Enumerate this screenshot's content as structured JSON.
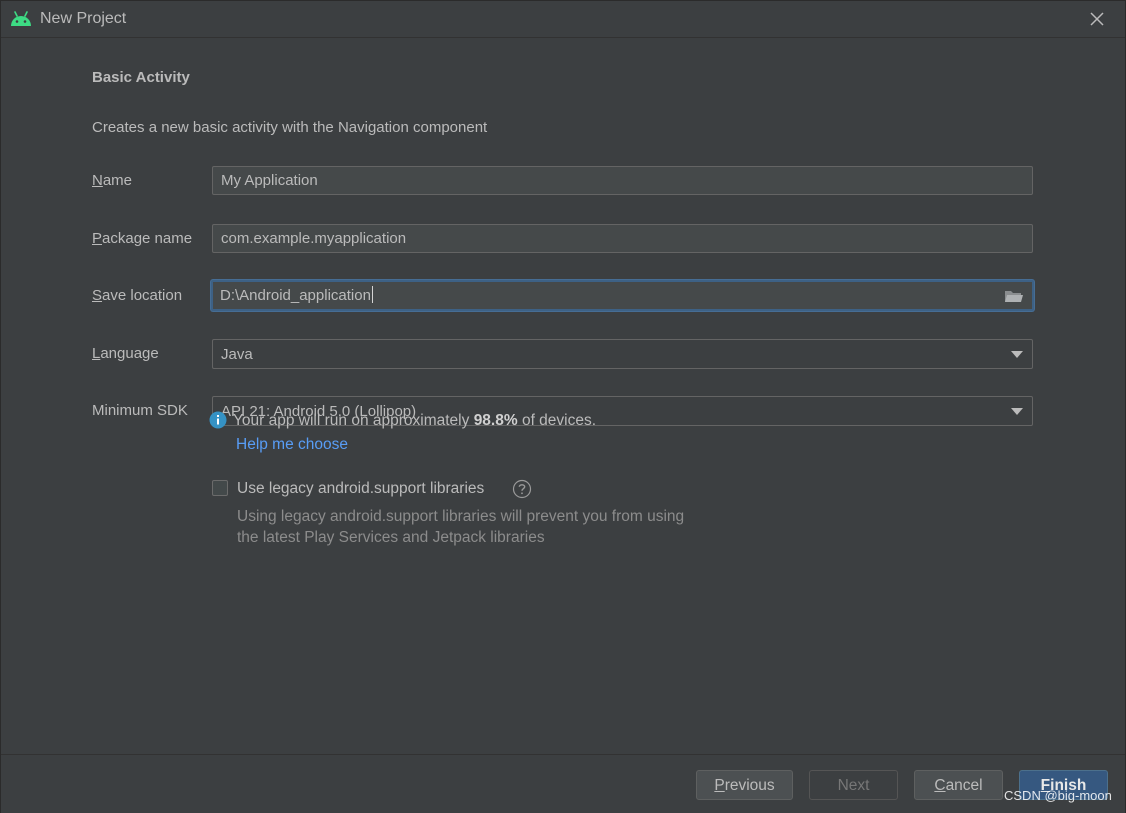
{
  "window": {
    "title": "New Project"
  },
  "heading": "Basic Activity",
  "description": "Creates a new basic activity with the Navigation component",
  "fields": {
    "name": {
      "label_mnemonic": "N",
      "label_rest": "ame",
      "value": "My Application"
    },
    "package": {
      "label_mnemonic": "P",
      "label_rest": "ackage name",
      "value": "com.example.myapplication"
    },
    "save_location": {
      "label_mnemonic": "S",
      "label_rest": "ave location",
      "value": "D:\\Android_application"
    },
    "language": {
      "label_mnemonic": "L",
      "label_rest": "anguage",
      "value": "Java"
    },
    "min_sdk": {
      "label": "Minimum SDK",
      "value": "API 21: Android 5.0 (Lollipop)"
    }
  },
  "info": {
    "prefix": "Your app will run on approximately ",
    "percent": "98.8%",
    "suffix": " of devices.",
    "help_link": "Help me choose"
  },
  "legacy": {
    "checkbox_label": "Use legacy android.support libraries",
    "checked": false,
    "note_line1": "Using legacy android.support libraries will prevent you from using",
    "note_line2": "the latest Play Services and Jetpack libraries"
  },
  "buttons": {
    "previous": {
      "mnemonic": "P",
      "rest": "revious"
    },
    "next": "Next",
    "cancel": {
      "mnemonic": "C",
      "rest": "ancel"
    },
    "finish": {
      "mnemonic": "F",
      "rest": "inish"
    }
  },
  "watermark": "CSDN @big-moon",
  "colors": {
    "background": "#3c3f41",
    "accent": "#365880",
    "link": "#589df6",
    "android_green": "#3ddc84",
    "info_blue": "#3592c4"
  }
}
